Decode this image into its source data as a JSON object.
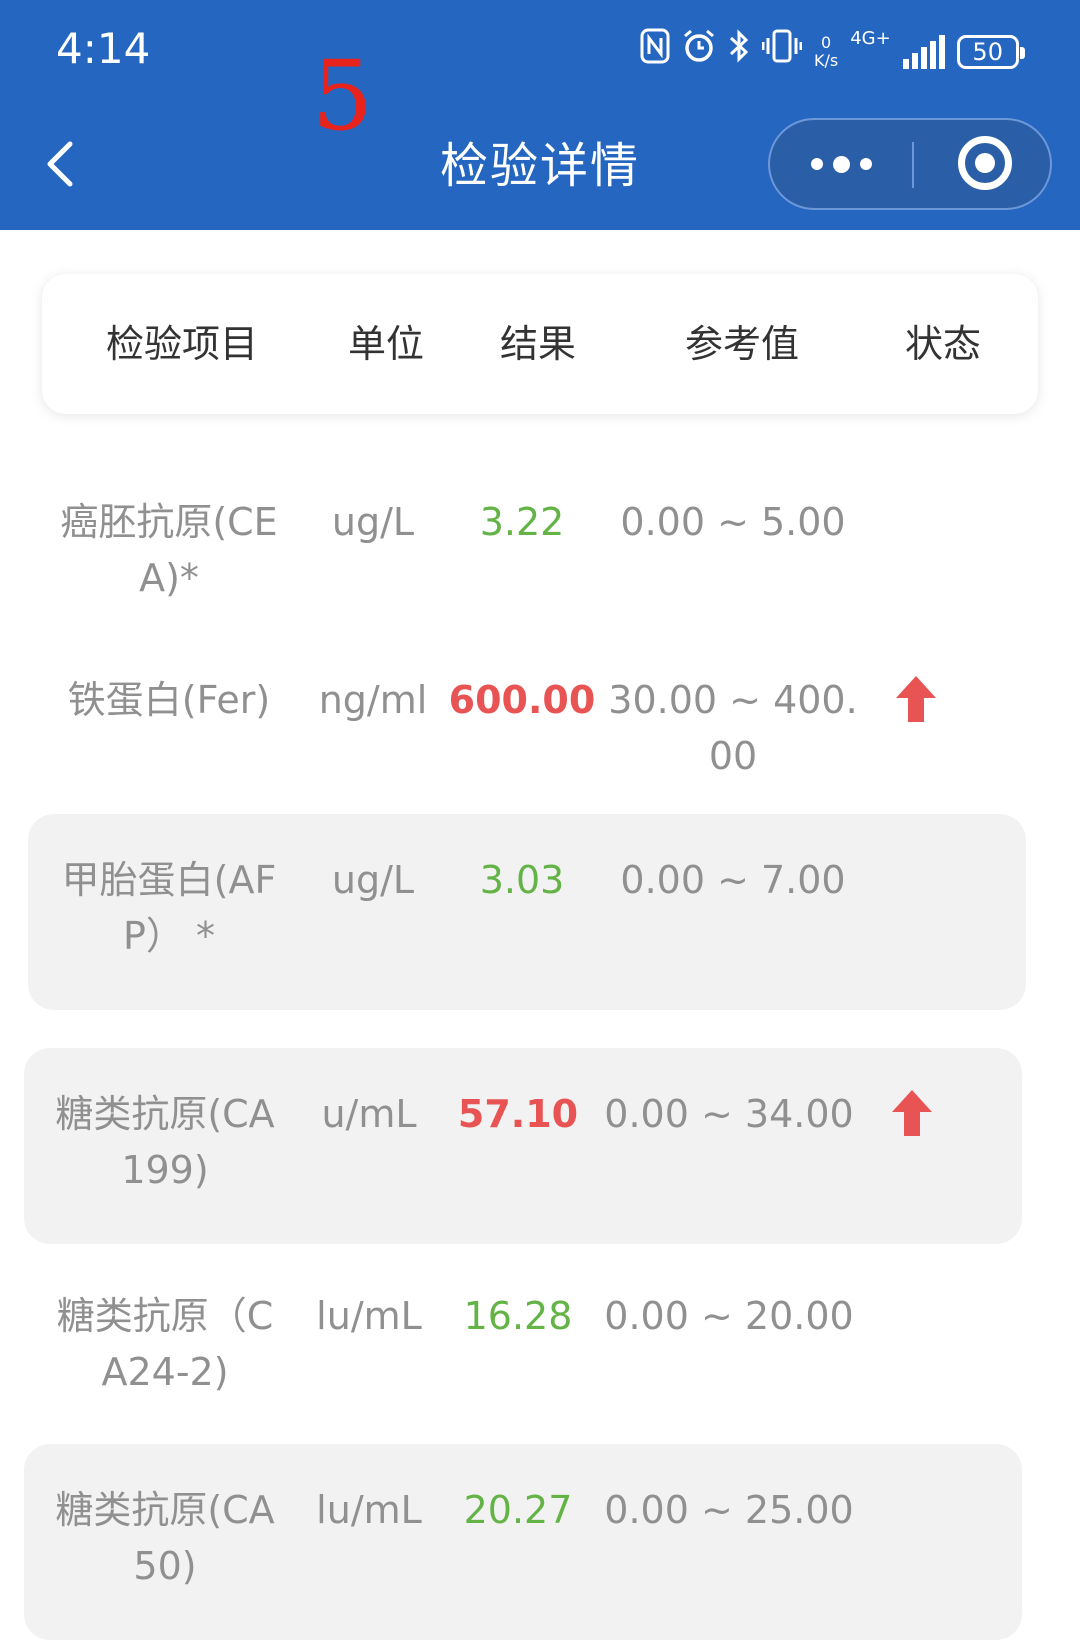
{
  "status_bar": {
    "time": "4:14",
    "net_speed_value": "0",
    "net_speed_unit": "K/s",
    "network": "4G+",
    "battery": "50",
    "icons": [
      "nfc-icon",
      "alarm-icon",
      "bluetooth-icon",
      "vibrate-icon",
      "net-speed-icon",
      "signal-icon",
      "battery-icon"
    ]
  },
  "annotation": "5",
  "nav": {
    "title": "检验详情",
    "back_icon": "chevron-left-icon",
    "more_icon": "more-dots-icon",
    "close_icon": "target-icon"
  },
  "table": {
    "headers": [
      "检验项目",
      "单位",
      "结果",
      "参考值",
      "状态"
    ],
    "rows": [
      {
        "name": [
          "癌胚抗原(CE",
          "A)*"
        ],
        "unit": "ug/L",
        "result": "3.22",
        "reference": [
          "0.00 ~ 5.00"
        ],
        "status": "",
        "shaded": false
      },
      {
        "name": [
          "铁蛋白(Fer)"
        ],
        "unit": "ng/ml",
        "result": "600.00",
        "reference": [
          "30.00 ~ 400.",
          "00"
        ],
        "status": "up",
        "shaded": false
      },
      {
        "name": [
          "甲胎蛋白(AF",
          "P） *"
        ],
        "unit": "ug/L",
        "result": "3.03",
        "reference": [
          "0.00 ~ 7.00"
        ],
        "status": "",
        "shaded": true
      },
      {
        "name": [
          "糖类抗原(CA",
          "199)"
        ],
        "unit": "u/mL",
        "result": "57.10",
        "reference": [
          "0.00 ~ 34.00"
        ],
        "status": "up",
        "shaded": true
      },
      {
        "name": [
          "糖类抗原（C",
          "A24-2)"
        ],
        "unit": "lu/mL",
        "result": "16.28",
        "reference": [
          "0.00 ~ 20.00"
        ],
        "status": "",
        "shaded": false
      },
      {
        "name": [
          "糖类抗原(CA",
          "50)"
        ],
        "unit": "lu/mL",
        "result": "20.27",
        "reference": [
          "0.00 ~ 25.00"
        ],
        "status": "",
        "shaded": true
      }
    ]
  },
  "colors": {
    "header_bg": "#2566c0",
    "normal_result": "#63b347",
    "abnormal_result": "#e85353",
    "annotation": "#e8231c"
  }
}
